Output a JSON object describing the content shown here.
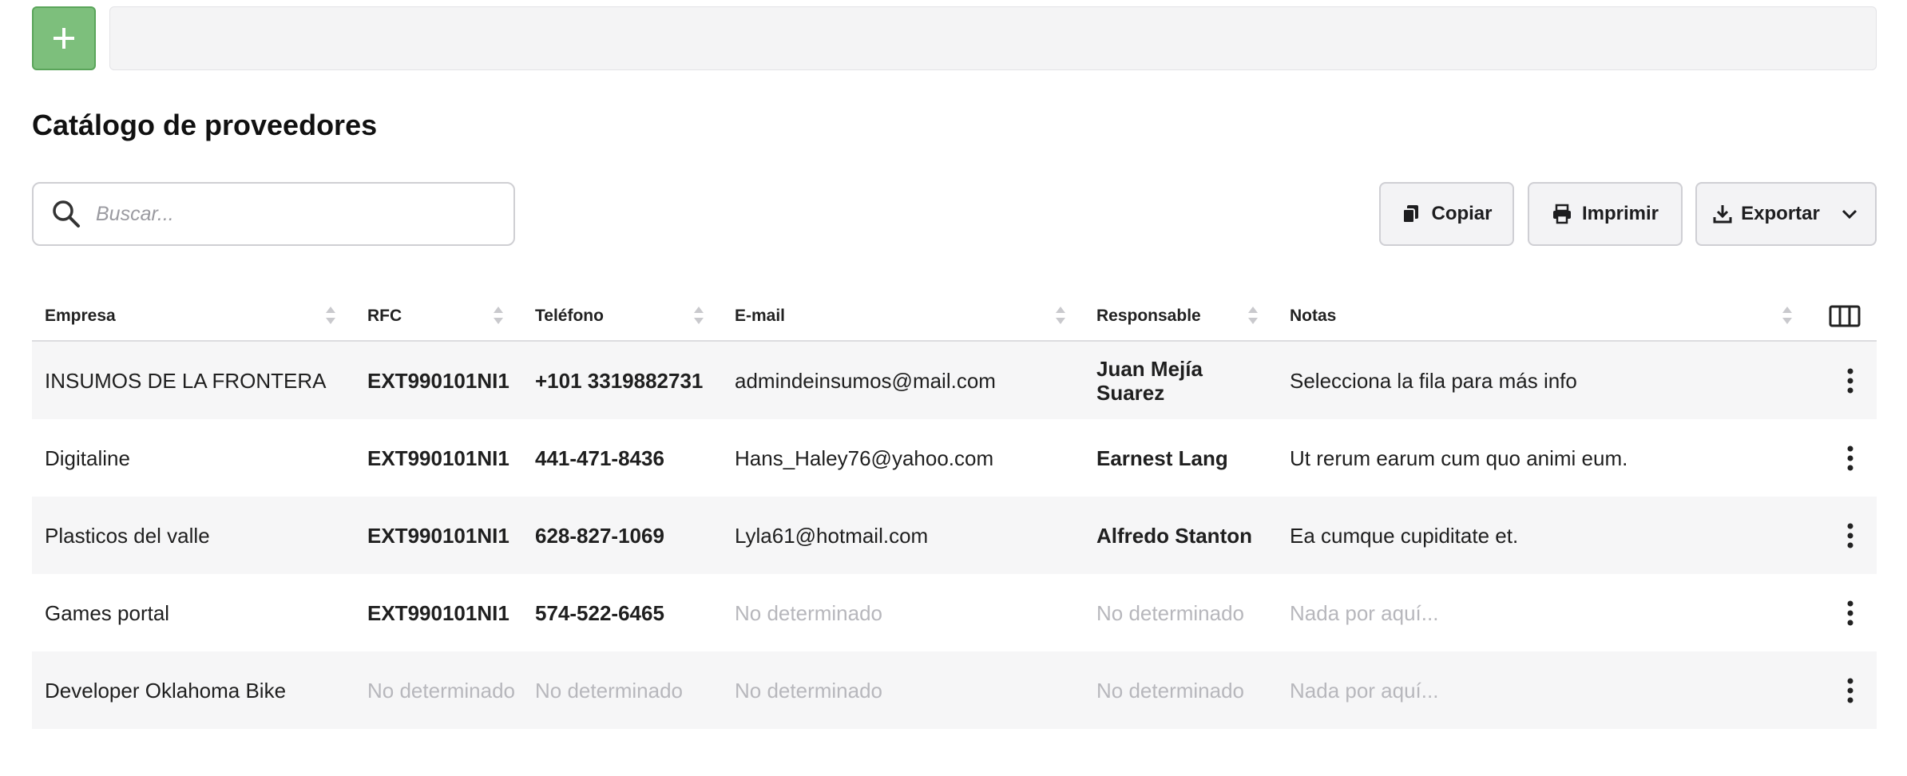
{
  "topbar": {
    "add_icon": "plus-icon",
    "field_value": ""
  },
  "page": {
    "title": "Catálogo de proveedores"
  },
  "search": {
    "placeholder": "Buscar...",
    "value": ""
  },
  "toolbar": {
    "copy_label": "Copiar",
    "print_label": "Imprimir",
    "export_label": "Exportar"
  },
  "table": {
    "columns": [
      "Empresa",
      "RFC",
      "Teléfono",
      "E-mail",
      "Responsable",
      "Notas"
    ],
    "rows": [
      {
        "empresa": "INSUMOS DE LA FRONTERA",
        "rfc": "EXT990101NI1",
        "telefono": "+101 3319882731",
        "email": "admindeinsumos@mail.com",
        "responsable": "Juan Mejía Suarez",
        "notas": "Selecciona la fila para más info"
      },
      {
        "empresa": "Digitaline",
        "rfc": "EXT990101NI1",
        "telefono": "441-471-8436",
        "email": "Hans_Haley76@yahoo.com",
        "responsable": "Earnest Lang",
        "notas": "Ut rerum earum cum quo animi eum."
      },
      {
        "empresa": "Plasticos del valle",
        "rfc": "EXT990101NI1",
        "telefono": "628-827-1069",
        "email": "Lyla61@hotmail.com",
        "responsable": "Alfredo Stanton",
        "notas": "Ea cumque cupiditate et."
      },
      {
        "empresa": "Games portal",
        "rfc": "EXT990101NI1",
        "telefono": "574-522-6465",
        "email": "No determinado",
        "responsable": "No determinado",
        "notas": "Nada por aquí..."
      },
      {
        "empresa": "Developer Oklahoma Bike",
        "rfc": "No determinado",
        "telefono": "No determinado",
        "email": "No determinado",
        "responsable": "No determinado",
        "notas": "Nada por aquí..."
      }
    ]
  },
  "colors": {
    "accent_green": "#7dbf7c",
    "muted_text": "#b7b7bc",
    "row_stripe": "#f6f6f7"
  }
}
